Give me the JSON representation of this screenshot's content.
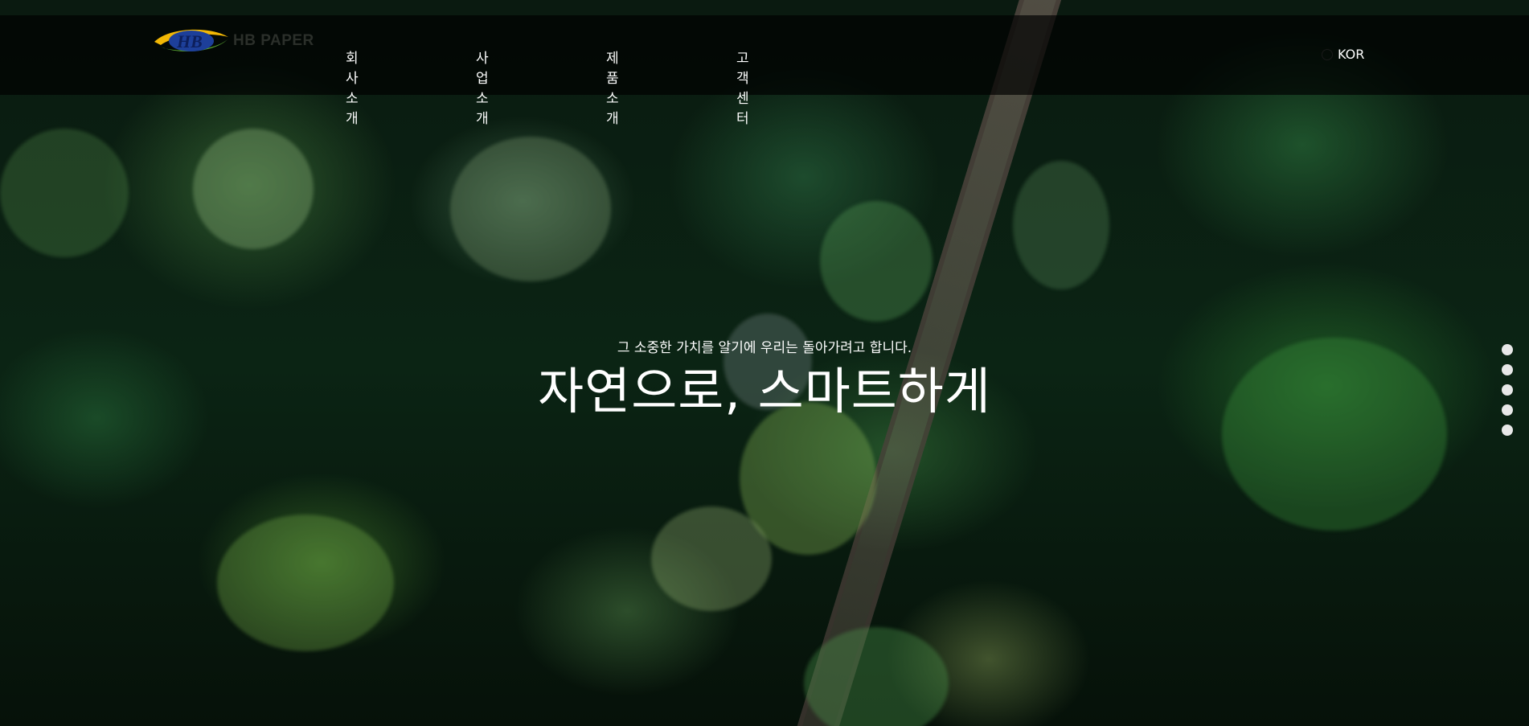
{
  "header": {
    "logo_text": "HB PAPER",
    "nav": [
      {
        "label": "회사소개"
      },
      {
        "label": "사업소개"
      },
      {
        "label": "제품소개"
      },
      {
        "label": "고객센터"
      }
    ],
    "language": "KOR",
    "icons": {
      "globe": "globe-icon"
    }
  },
  "hero": {
    "subtitle": "그 소중한 가치를 알기에 우리는 돌아가려고 합니다.",
    "title": "자연으로, 스마트하게",
    "slide_count": 5
  },
  "colors": {
    "header_bg": "#000000",
    "text": "#ffffff",
    "logo_yellow": "#f2b705",
    "logo_blue": "#1d3f9a",
    "logo_green": "#5aa832"
  }
}
